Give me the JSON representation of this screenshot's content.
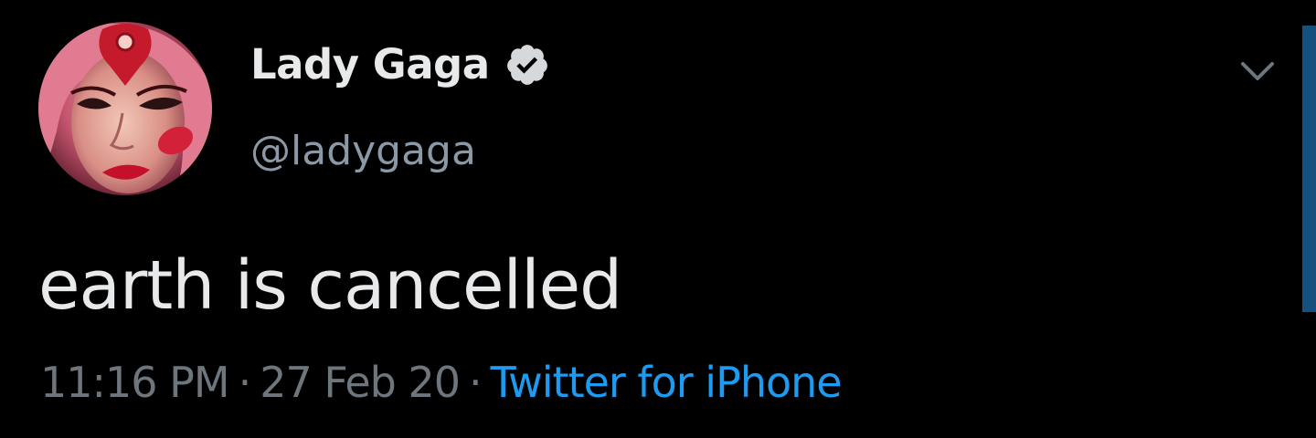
{
  "author": {
    "display_name": "Lady Gaga",
    "handle": "@ladygaga",
    "verified": true,
    "avatar_icon": "avatar-photo"
  },
  "tweet": {
    "text": "earth is cancelled"
  },
  "meta": {
    "time": "11:16 PM",
    "separator": "·",
    "date": "27 Feb 20",
    "source": "Twitter for iPhone"
  },
  "icons": {
    "verified": "verified-badge-icon",
    "menu": "chevron-down-icon"
  },
  "colors": {
    "background": "#000000",
    "text": "#e7e9ea",
    "secondary": "#8b98a5",
    "meta": "#6e767d",
    "link": "#1d9bf0",
    "accent_bar": "#14517f"
  }
}
